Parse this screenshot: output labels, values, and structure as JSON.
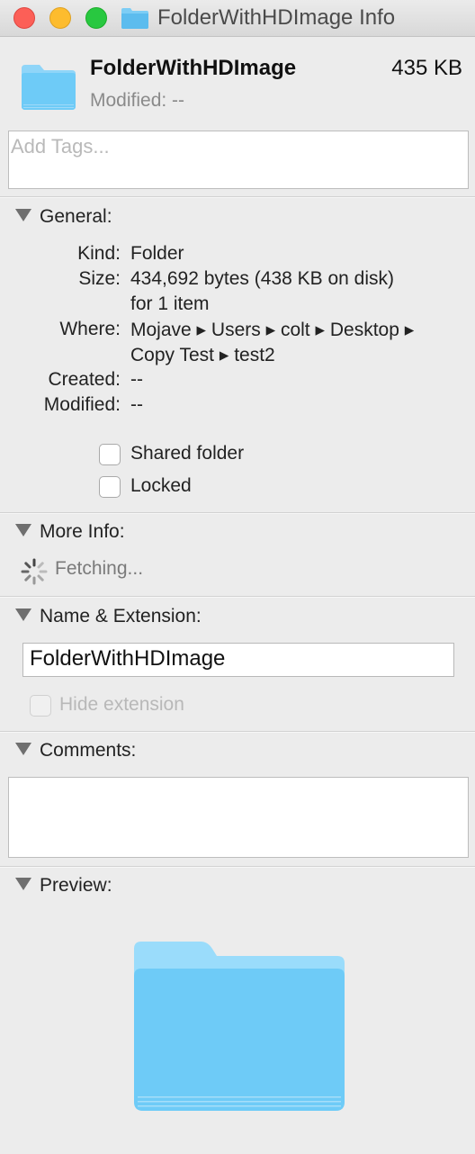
{
  "window": {
    "title": "FolderWithHDImage Info",
    "controls": [
      "close",
      "minimize",
      "zoom"
    ]
  },
  "header": {
    "icon": "folder-icon",
    "name": "FolderWithHDImage",
    "size": "435 KB",
    "modified": "Modified: --"
  },
  "tags": {
    "placeholder": "Add Tags..."
  },
  "general": {
    "title": "General:",
    "kind_label": "Kind:",
    "kind_value": "Folder",
    "size_label": "Size:",
    "size_value_line1": "434,692 bytes (438 KB on disk)",
    "size_value_line2": "for 1 item",
    "where_label": "Where:",
    "where_line1": "Mojave ▸ Users ▸ colt ▸ Desktop ▸",
    "where_line2": "Copy Test ▸ test2",
    "created_label": "Created:",
    "created_value": "--",
    "modified_label": "Modified:",
    "modified_value": "--",
    "shared_folder": "Shared folder",
    "locked": "Locked"
  },
  "more_info": {
    "title": "More Info:",
    "status": "Fetching..."
  },
  "name_extension": {
    "title": "Name & Extension:",
    "value": "FolderWithHDImage",
    "hide_extension": "Hide extension"
  },
  "comments": {
    "title": "Comments:",
    "value": ""
  },
  "preview": {
    "title": "Preview:",
    "icon": "folder-icon"
  },
  "colors": {
    "folder": "#6ecbf7",
    "close": "#fc5f57",
    "minimize": "#fdbc2e",
    "zoom": "#28c840"
  }
}
